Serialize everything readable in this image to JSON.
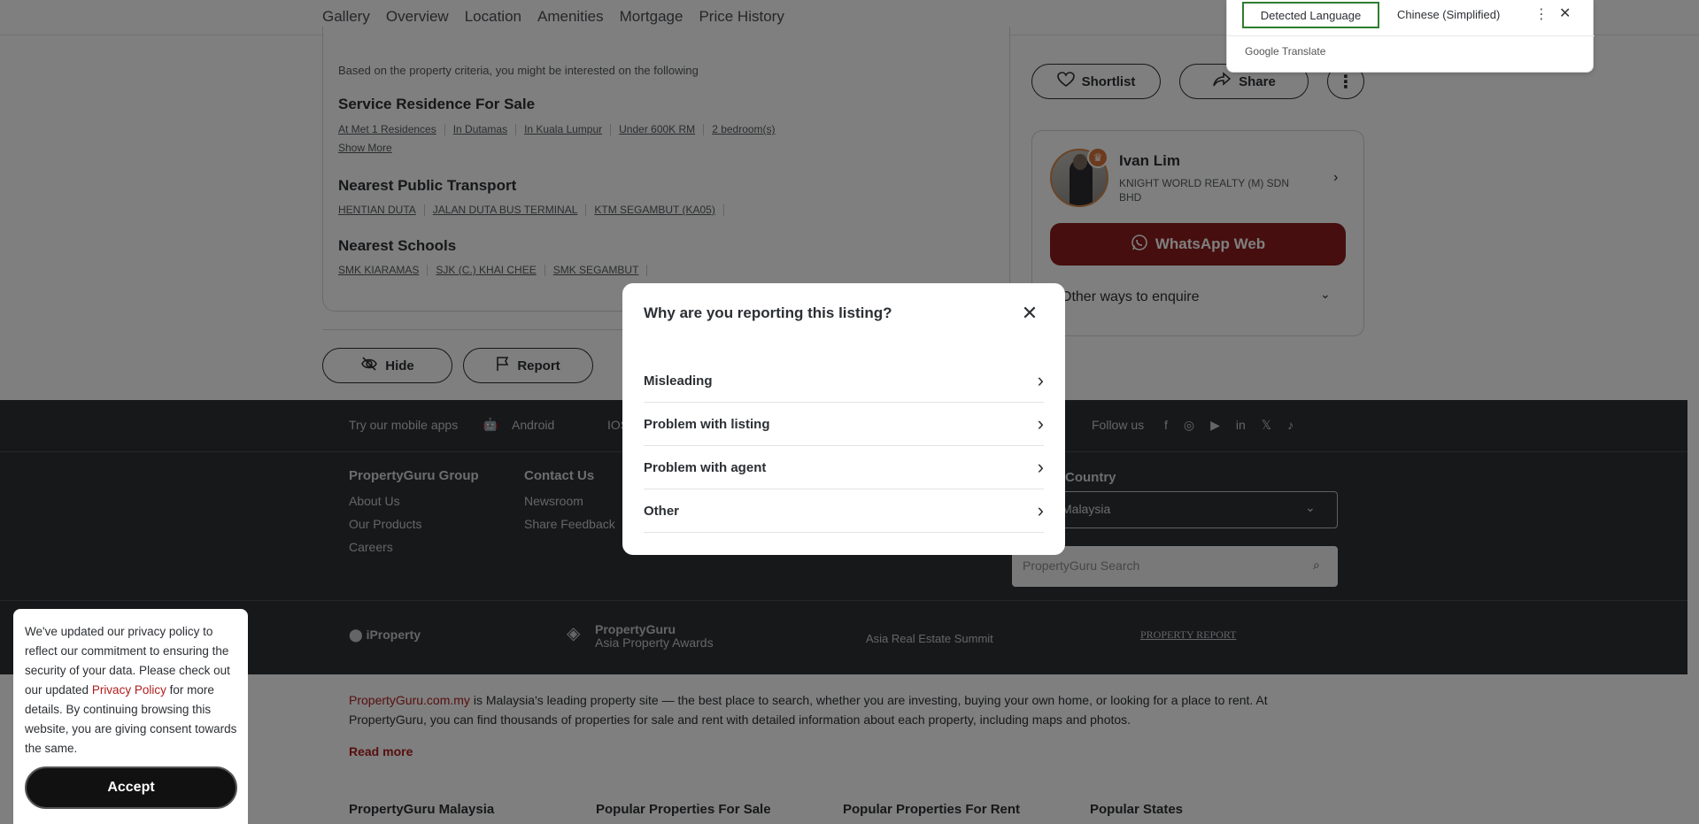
{
  "nav": {
    "items": [
      "Gallery",
      "Overview",
      "Location",
      "Amenities",
      "Mortgage",
      "Price History"
    ]
  },
  "content": {
    "intro": "Based on the property criteria, you might be interested on the following",
    "sections": [
      {
        "title": "Service Residence For Sale",
        "chips": [
          "At Met 1 Residences",
          "In Dutamas",
          "In Kuala Lumpur",
          "Under 600K RM",
          "2 bedroom(s)"
        ]
      },
      {
        "title": "Nearest Public Transport",
        "chips": [
          "HENTIAN DUTA",
          "JALAN DUTA BUS TERMINAL",
          "KTM SEGAMBUT (KA05)"
        ]
      },
      {
        "title": "Nearest Schools",
        "chips": [
          "SMK KIARAMAS",
          "SJK (C.) KHAI CHEE",
          "SMK SEGAMBUT"
        ]
      }
    ],
    "show_more": "Show More",
    "hide_label": "Hide",
    "report_label": "Report"
  },
  "sidebar": {
    "shortlist_label": "Shortlist",
    "share_label": "Share",
    "agent": {
      "name": "Ivan Lim",
      "company": "KNIGHT WORLD REALTY (M) SDN BHD",
      "whatsapp_label": "WhatsApp Web",
      "other_ways": "Other ways to enquire"
    }
  },
  "footer": {
    "apps_label": "Try our mobile apps",
    "android": "Android",
    "ios": "IOS",
    "follow_us": "Follow us",
    "group_title": "PropertyGuru Group",
    "group_links": [
      "About Us",
      "Our Products",
      "Careers"
    ],
    "contact_title": "Contact Us",
    "contact_links": [
      "Newsroom",
      "Share Feedback"
    ],
    "country_title": "Country",
    "country_value": "Malaysia",
    "search_placeholder": "PropertyGuru Search",
    "brands": [
      "iProperty",
      "PropertyGuru",
      "Asia Property Awards",
      "Asia Real Estate Summit",
      "PROPERTY REPORT"
    ],
    "about_link": "PropertyGuru.com.my",
    "about_text": " is Malaysia's leading property site — the best place to search, whether you are investing, buying your own home, or looking for a place to rent. At PropertyGuru, you can find thousands of properties for sale and rent with detailed information about each property, including maps and photos.",
    "read_more": "Read more",
    "columns": [
      "PropertyGuru Malaysia",
      "Popular Properties For Sale",
      "Popular Properties For Rent",
      "Popular States"
    ]
  },
  "modal": {
    "title": "Why are you reporting this listing?",
    "reasons": [
      "Misleading",
      "Problem with listing",
      "Problem with agent",
      "Other"
    ]
  },
  "cookie": {
    "text_before": "We've updated our privacy policy to reflect our commitment to ensuring the security of your data. Please check out our updated ",
    "link": "Privacy Policy",
    "text_after": " for more details. By continuing browsing this website, you are giving consent towards the same.",
    "accept": "Accept"
  },
  "translate": {
    "detected": "Detected Language",
    "target": "Chinese (Simplified)",
    "brand": "Google Translate"
  },
  "colors": {
    "accent_red": "#8c1d1d",
    "footer_bg": "#2d3034",
    "translate_green": "#2e7d32"
  }
}
